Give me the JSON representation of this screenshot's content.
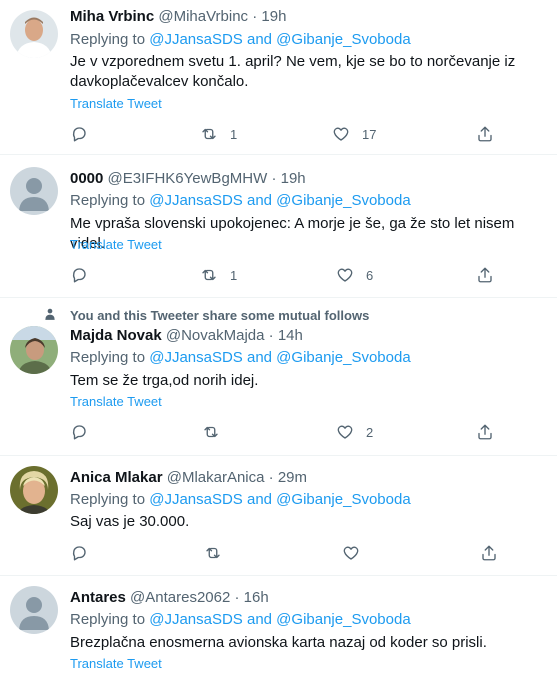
{
  "reply_prefix": "Replying to",
  "reply_mentions": "@JJansaSDS and @Gibanje_Svoboda",
  "translate_label": "Translate Tweet",
  "tweets": [
    {
      "name": "Miha Vrbinc",
      "handle": "@MihaVrbinc",
      "dot": "·",
      "time": "19h",
      "text": "Je v vzporednem svetu 1. april? Ne vem, kje se bo to norčevanje iz davkoplačevalcev končalo.",
      "retweets": "1",
      "likes": "17"
    },
    {
      "name": "0000",
      "handle": "@E3IFHK6YewBgMHW",
      "dot": "·",
      "time": "19h",
      "text": "Me vpraša slovenski upokojenec: A morje je še, ga že sto let nisem videl.",
      "retweets": "1",
      "likes": "6"
    },
    {
      "social_context": "You and this Tweeter share some mutual follows",
      "name": "Majda Novak",
      "handle": "@NovakMajda",
      "dot": "·",
      "time": "14h",
      "text": "Tem se že trga,od norih idej.",
      "retweets": "",
      "likes": "2"
    },
    {
      "name": "Anica Mlakar",
      "handle": "@MlakarAnica",
      "dot": "·",
      "time": "29m",
      "text": "Saj vas je 30.000.",
      "retweets": "",
      "likes": ""
    },
    {
      "name": "Antares",
      "handle": "@Antares2062",
      "dot": "·",
      "time": "16h",
      "text": "Brezplačna enosmerna avionska karta nazaj od koder so prisli."
    }
  ],
  "icons": {
    "reply": "reply-icon",
    "retweet": "retweet-icon",
    "like": "heart-icon",
    "share": "share-icon",
    "person": "person-icon"
  },
  "colors": {
    "link": "#1d9bf0",
    "secondary_text": "#536471",
    "primary_text": "#0f1419",
    "divider": "#eff3f4"
  }
}
